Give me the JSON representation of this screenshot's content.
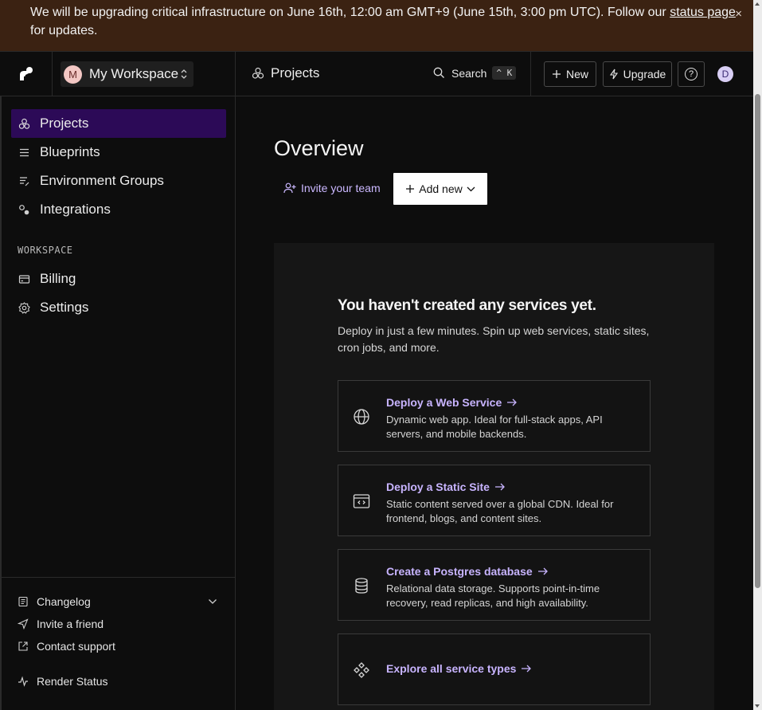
{
  "banner": {
    "text_before": "We will be upgrading critical infrastructure on June 16th, 12:00 am GMT+9 (June 15th, 3:00 pm UTC). Follow our ",
    "link_text": "status page",
    "text_after": " for updates.",
    "close_glyph": "×"
  },
  "topbar": {
    "workspace_initial": "M",
    "workspace_name": "My Workspace",
    "breadcrumb": "Projects",
    "search_label": "Search",
    "search_shortcut": "^ K",
    "new_label": "New",
    "upgrade_label": "Upgrade",
    "help_glyph": "?",
    "user_initial": "D"
  },
  "sidebar": {
    "items": [
      {
        "label": "Projects",
        "icon": "projects-icon",
        "active": true
      },
      {
        "label": "Blueprints",
        "icon": "blueprints-icon"
      },
      {
        "label": "Environment Groups",
        "icon": "environment-groups-icon"
      },
      {
        "label": "Integrations",
        "icon": "integrations-icon"
      }
    ],
    "section_label": "WORKSPACE",
    "workspace_items": [
      {
        "label": "Billing",
        "icon": "billing-icon"
      },
      {
        "label": "Settings",
        "icon": "gear-icon"
      }
    ],
    "footer": [
      {
        "label": "Changelog",
        "icon": "changelog-icon"
      },
      {
        "label": "Invite a friend",
        "icon": "send-icon"
      },
      {
        "label": "Contact support",
        "icon": "external-link-icon"
      },
      {
        "label": "Render Status",
        "icon": "pulse-icon"
      }
    ]
  },
  "main": {
    "title": "Overview",
    "invite_label": "Invite your team",
    "add_new_label": "Add new",
    "empty": {
      "title": "You haven't created any services yet.",
      "description": "Deploy in just a few minutes. Spin up web services, static sites, cron jobs, and more."
    },
    "cards": [
      {
        "title": "Deploy a Web Service",
        "description": "Dynamic web app. Ideal for full-stack apps, API servers, and mobile backends.",
        "icon": "globe-icon"
      },
      {
        "title": "Deploy a Static Site",
        "description": "Static content served over a global CDN. Ideal for frontend, blogs, and content sites.",
        "icon": "browser-code-icon"
      },
      {
        "title": "Create a Postgres database",
        "description": "Relational data storage. Supports point-in-time recovery, read replicas, and high availability.",
        "icon": "database-icon"
      },
      {
        "title": "Explore all service types",
        "description": "",
        "icon": "service-types-icon"
      }
    ]
  },
  "colors": {
    "banner_bg": "#3b2212",
    "active_nav_bg": "#2c0a57",
    "link_accent": "#c8b4ff",
    "panel_bg": "#161616"
  }
}
